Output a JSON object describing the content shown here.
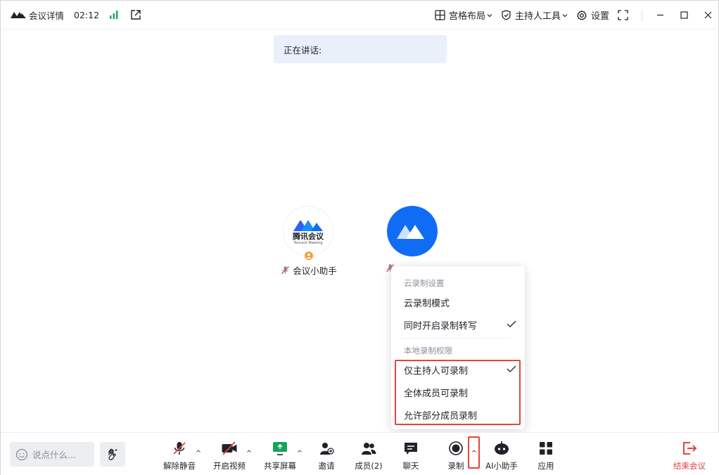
{
  "titlebar": {
    "title": "会议详情",
    "time": "02:12",
    "layout_label": "宫格布局",
    "host_tools_label": "主持人工具",
    "settings_label": "设置"
  },
  "speaking": {
    "label": "正在讲话:"
  },
  "participants": [
    {
      "name": "会议小助手",
      "logo_text": "腾讯会议",
      "logo_sub": "Tencent Meeting"
    }
  ],
  "menu": {
    "cloud_header": "云录制设置",
    "cloud_mode": "云录制模式",
    "cloud_transcribe": "同时开启录制转写",
    "local_header": "本地录制权限",
    "host_only": "仅主持人可录制",
    "all_members": "全体成员可录制",
    "some_members": "允许部分成员录制"
  },
  "toolbar": {
    "chat_placeholder": "说点什么...",
    "unmute": "解除静音",
    "video": "开启视频",
    "share": "共享屏幕",
    "invite": "邀请",
    "members": "成员(2)",
    "chat": "聊天",
    "record": "录制",
    "ai": "AI小助手",
    "apps": "应用",
    "end": "结束会议"
  },
  "colors": {
    "accent": "#0f6df5",
    "danger": "#e0463f",
    "signal": "#1aad5f",
    "share": "#16a35a"
  }
}
